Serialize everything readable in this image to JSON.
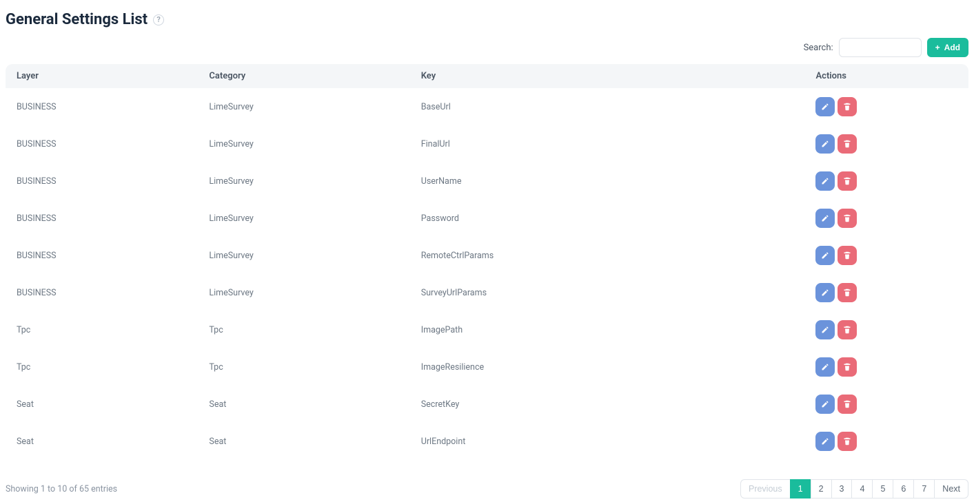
{
  "header": {
    "title": "General Settings List"
  },
  "toolbar": {
    "search_label": "Search:",
    "search_placeholder": "",
    "add_label": "Add"
  },
  "table": {
    "headers": {
      "layer": "Layer",
      "category": "Category",
      "key": "Key",
      "actions": "Actions"
    },
    "rows": [
      {
        "layer": "BUSINESS",
        "category": "LimeSurvey",
        "key": "BaseUrl"
      },
      {
        "layer": "BUSINESS",
        "category": "LimeSurvey",
        "key": "FinalUrl"
      },
      {
        "layer": "BUSINESS",
        "category": "LimeSurvey",
        "key": "UserName"
      },
      {
        "layer": "BUSINESS",
        "category": "LimeSurvey",
        "key": "Password"
      },
      {
        "layer": "BUSINESS",
        "category": "LimeSurvey",
        "key": "RemoteCtrlParams"
      },
      {
        "layer": "BUSINESS",
        "category": "LimeSurvey",
        "key": "SurveyUrlParams"
      },
      {
        "layer": "Tpc",
        "category": "Tpc",
        "key": "ImagePath"
      },
      {
        "layer": "Tpc",
        "category": "Tpc",
        "key": "ImageResilience"
      },
      {
        "layer": "Seat",
        "category": "Seat",
        "key": "SecretKey"
      },
      {
        "layer": "Seat",
        "category": "Seat",
        "key": "UrlEndpoint"
      }
    ]
  },
  "footer": {
    "showing_text": "Showing 1 to 10 of 65 entries"
  },
  "pagination": {
    "previous_label": "Previous",
    "next_label": "Next",
    "pages": [
      "1",
      "2",
      "3",
      "4",
      "5",
      "6",
      "7"
    ],
    "active": "1"
  }
}
